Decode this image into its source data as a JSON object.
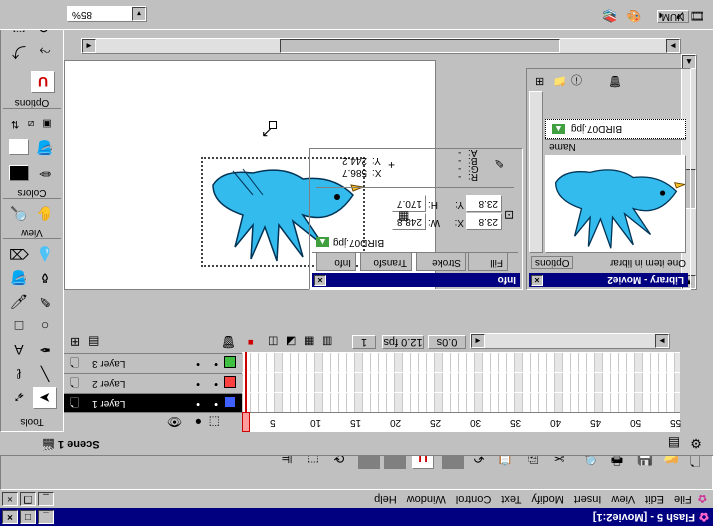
{
  "window": {
    "title": "Flash 5 - [Movie2:1]"
  },
  "menu": [
    "File",
    "Edit",
    "View",
    "Insert",
    "Modify",
    "Text",
    "Control",
    "Window",
    "Help"
  ],
  "scene": {
    "label": "Scene 1"
  },
  "tools": {
    "label": "Tools",
    "view_label": "View",
    "colors_label": "Colors",
    "options_label": "Options"
  },
  "zoom": {
    "value": "85%"
  },
  "timeline": {
    "layers": [
      {
        "name": "Layer 1",
        "color": "#4060ff",
        "selected": true
      },
      {
        "name": "Layer 2",
        "color": "#ff4040",
        "selected": false
      },
      {
        "name": "Layer 3",
        "color": "#40c040",
        "selected": false
      }
    ],
    "ruler": [
      "1",
      "5",
      "10",
      "15",
      "20",
      "25",
      "30",
      "35",
      "40",
      "45",
      "50",
      "55"
    ],
    "current_frame": "1",
    "fps": "12.0 fps",
    "elapsed": "0.0s"
  },
  "info_panel": {
    "title": "Info",
    "tabs": [
      "Info",
      "Transfo",
      "Stroke",
      "Fill"
    ],
    "object_name": "BIRD07.jpg",
    "w_label": "W:",
    "w_value": "248.8",
    "h_label": "H:",
    "h_value": "170.7",
    "x_label": "X:",
    "x_value": "23.8",
    "y_label": "Y:",
    "y_value": "23.8",
    "r_label": "R:",
    "g_label": "G:",
    "b_label": "B:",
    "a_label": "A:",
    "rgba_value": "-",
    "cursor_x_label": "X:",
    "cursor_x_value": "586.7",
    "cursor_y_label": "Y:",
    "cursor_y_value": "244.2"
  },
  "library_panel": {
    "title": "Library - Movie2",
    "count_text": "One item in librar",
    "options_label": "Options",
    "name_header": "Name",
    "item_name": "BIRD07.jpg"
  },
  "status": {
    "num": "NUM"
  },
  "colors": {
    "accent": "#000080",
    "bird": "#33bbee",
    "beak": "#ffc020"
  }
}
